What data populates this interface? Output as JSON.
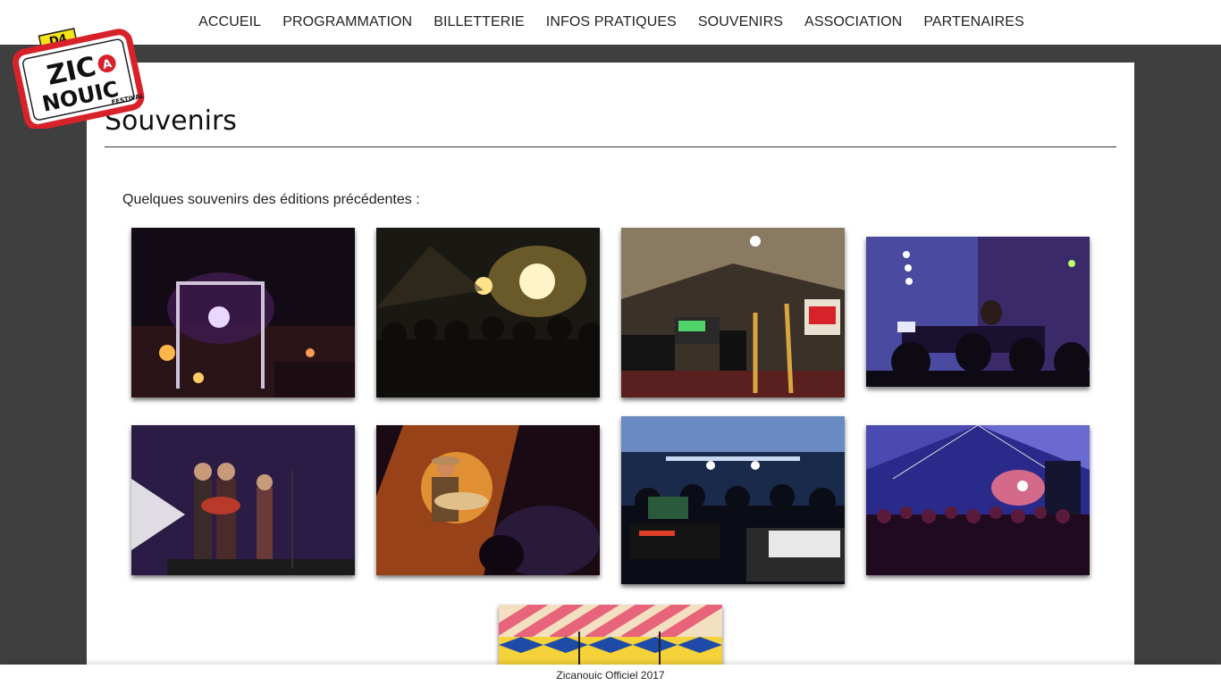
{
  "nav": {
    "items": [
      {
        "label": "ACCUEIL"
      },
      {
        "label": "PROGRAMMATION"
      },
      {
        "label": "BILLETTERIE"
      },
      {
        "label": "INFOS PRATIQUES"
      },
      {
        "label": "SOUVENIRS"
      },
      {
        "label": "ASSOCIATION"
      },
      {
        "label": "PARTENAIRES"
      }
    ]
  },
  "logo": {
    "top_badge": "D4",
    "line1": "ZIC",
    "line2": "NOUIC",
    "letter": "A",
    "side": "FESTIVAL"
  },
  "page": {
    "title": "Souvenirs",
    "intro": "Quelques souvenirs des éditions précédentes :"
  },
  "gallery": {
    "photos": [
      {
        "subject": "night-festival-grounds"
      },
      {
        "subject": "crowd-stage-lights"
      },
      {
        "subject": "stage-instruments-tent"
      },
      {
        "subject": "dj-set-purple"
      },
      {
        "subject": "band-on-stage"
      },
      {
        "subject": "guitarist-orange-light"
      },
      {
        "subject": "mixing-desk-crowd"
      },
      {
        "subject": "big-top-crowd"
      },
      {
        "subject": "big-top-canvas"
      }
    ]
  },
  "footer": {
    "text": "Zicanouic Officiel 2017"
  },
  "colors": {
    "background": "#3f3f3f",
    "panel": "#ffffff",
    "logo_red": "#d8222a"
  }
}
